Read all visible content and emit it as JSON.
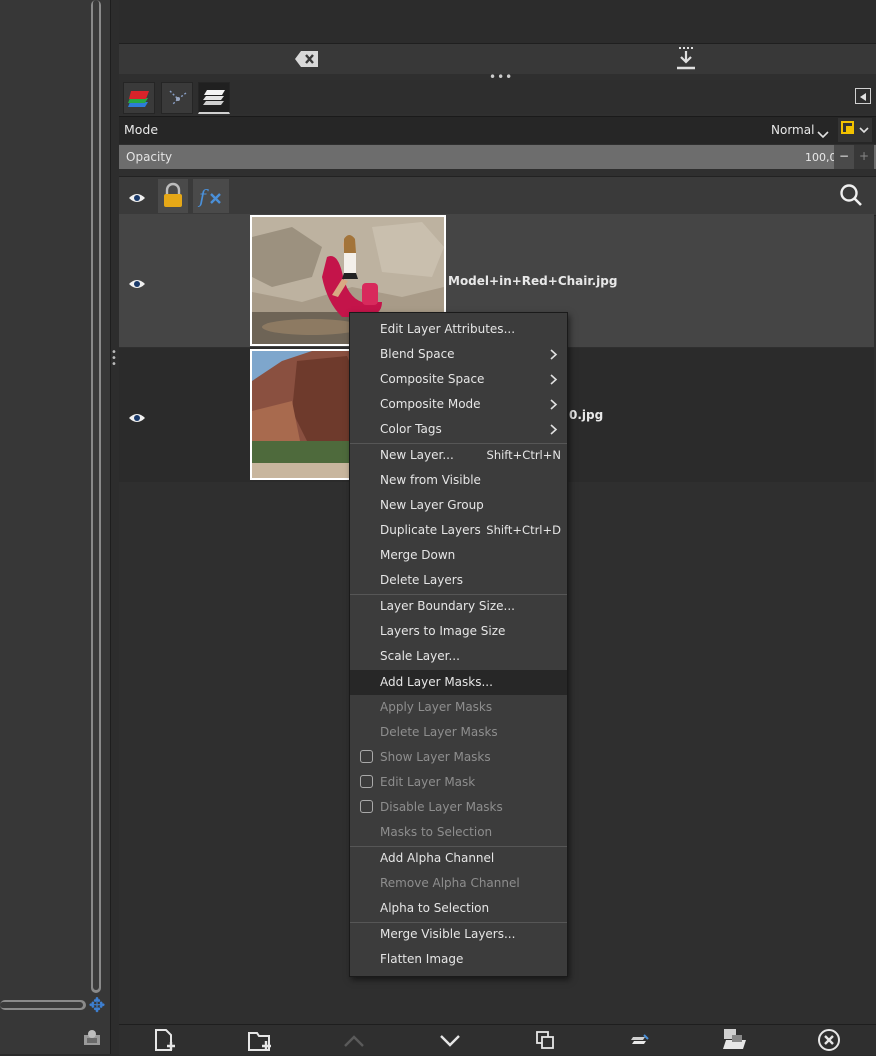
{
  "layers_panel": {
    "mode_label": "Mode",
    "mode_value": "Normal",
    "opacity_label": "Opacity",
    "opacity_value": "100,0",
    "opacity_minus": "−",
    "opacity_plus": "+",
    "layers": [
      {
        "name": "Model+in+Red+Chair.jpg",
        "visible": true,
        "selected": true
      },
      {
        "name": "0.jpg",
        "visible": true,
        "selected": false
      }
    ]
  },
  "context_menu": {
    "items": [
      {
        "label": "Edit Layer Attributes...",
        "accel": "",
        "submenu": false,
        "disabled": false
      },
      {
        "label": "Blend Space",
        "accel": "",
        "submenu": true,
        "disabled": false
      },
      {
        "label": "Composite Space",
        "accel": "",
        "submenu": true,
        "disabled": false
      },
      {
        "label": "Composite Mode",
        "accel": "",
        "submenu": true,
        "disabled": false
      },
      {
        "label": "Color Tags",
        "accel": "",
        "submenu": true,
        "disabled": false
      },
      {
        "label": "New Layer...",
        "accel": "Shift+Ctrl+N",
        "submenu": false,
        "disabled": false
      },
      {
        "label": "New from Visible",
        "accel": "",
        "submenu": false,
        "disabled": false
      },
      {
        "label": "New Layer Group",
        "accel": "",
        "submenu": false,
        "disabled": false
      },
      {
        "label": "Duplicate Layers",
        "accel": "Shift+Ctrl+D",
        "submenu": false,
        "disabled": false
      },
      {
        "label": "Merge Down",
        "accel": "",
        "submenu": false,
        "disabled": false
      },
      {
        "label": "Delete Layers",
        "accel": "",
        "submenu": false,
        "disabled": false
      },
      {
        "label": "Layer Boundary Size...",
        "accel": "",
        "submenu": false,
        "disabled": false
      },
      {
        "label": "Layers to Image Size",
        "accel": "",
        "submenu": false,
        "disabled": false
      },
      {
        "label": "Scale Layer...",
        "accel": "",
        "submenu": false,
        "disabled": false
      },
      {
        "label": "Add Layer Masks...",
        "accel": "",
        "submenu": false,
        "disabled": false,
        "highlighted": true
      },
      {
        "label": "Apply Layer Masks",
        "accel": "",
        "submenu": false,
        "disabled": true
      },
      {
        "label": "Delete Layer Masks",
        "accel": "",
        "submenu": false,
        "disabled": true
      },
      {
        "label": "Show Layer Masks",
        "accel": "",
        "submenu": false,
        "disabled": true,
        "checkbox": true
      },
      {
        "label": "Edit Layer Mask",
        "accel": "",
        "submenu": false,
        "disabled": true,
        "checkbox": true
      },
      {
        "label": "Disable Layer Masks",
        "accel": "",
        "submenu": false,
        "disabled": true,
        "checkbox": true
      },
      {
        "label": "Masks to Selection",
        "accel": "",
        "submenu": false,
        "disabled": true
      },
      {
        "label": "Add Alpha Channel",
        "accel": "",
        "submenu": false,
        "disabled": false
      },
      {
        "label": "Remove Alpha Channel",
        "accel": "",
        "submenu": false,
        "disabled": true
      },
      {
        "label": "Alpha to Selection",
        "accel": "",
        "submenu": false,
        "disabled": false
      },
      {
        "label": "Merge Visible Layers...",
        "accel": "",
        "submenu": false,
        "disabled": false
      },
      {
        "label": "Flatten Image",
        "accel": "",
        "submenu": false,
        "disabled": false
      }
    ]
  },
  "icons": {
    "clear": "clear-icon",
    "download": "download-icon",
    "tab_layers": "layers-tab-icon",
    "tab_paths": "paths-tab-icon",
    "tab_channels": "channels-tab-icon",
    "eye": "eye-icon",
    "lock": "lock-icon",
    "fx": "fx-icon",
    "search": "search-icon",
    "new_layer": "new-layer-icon",
    "new_group": "new-layer-group-icon",
    "raise": "raise-layer-icon",
    "lower": "lower-layer-icon",
    "duplicate": "duplicate-layer-icon",
    "anchor": "anchor-layer-icon",
    "mask": "add-mask-icon",
    "delete": "delete-layer-icon"
  }
}
